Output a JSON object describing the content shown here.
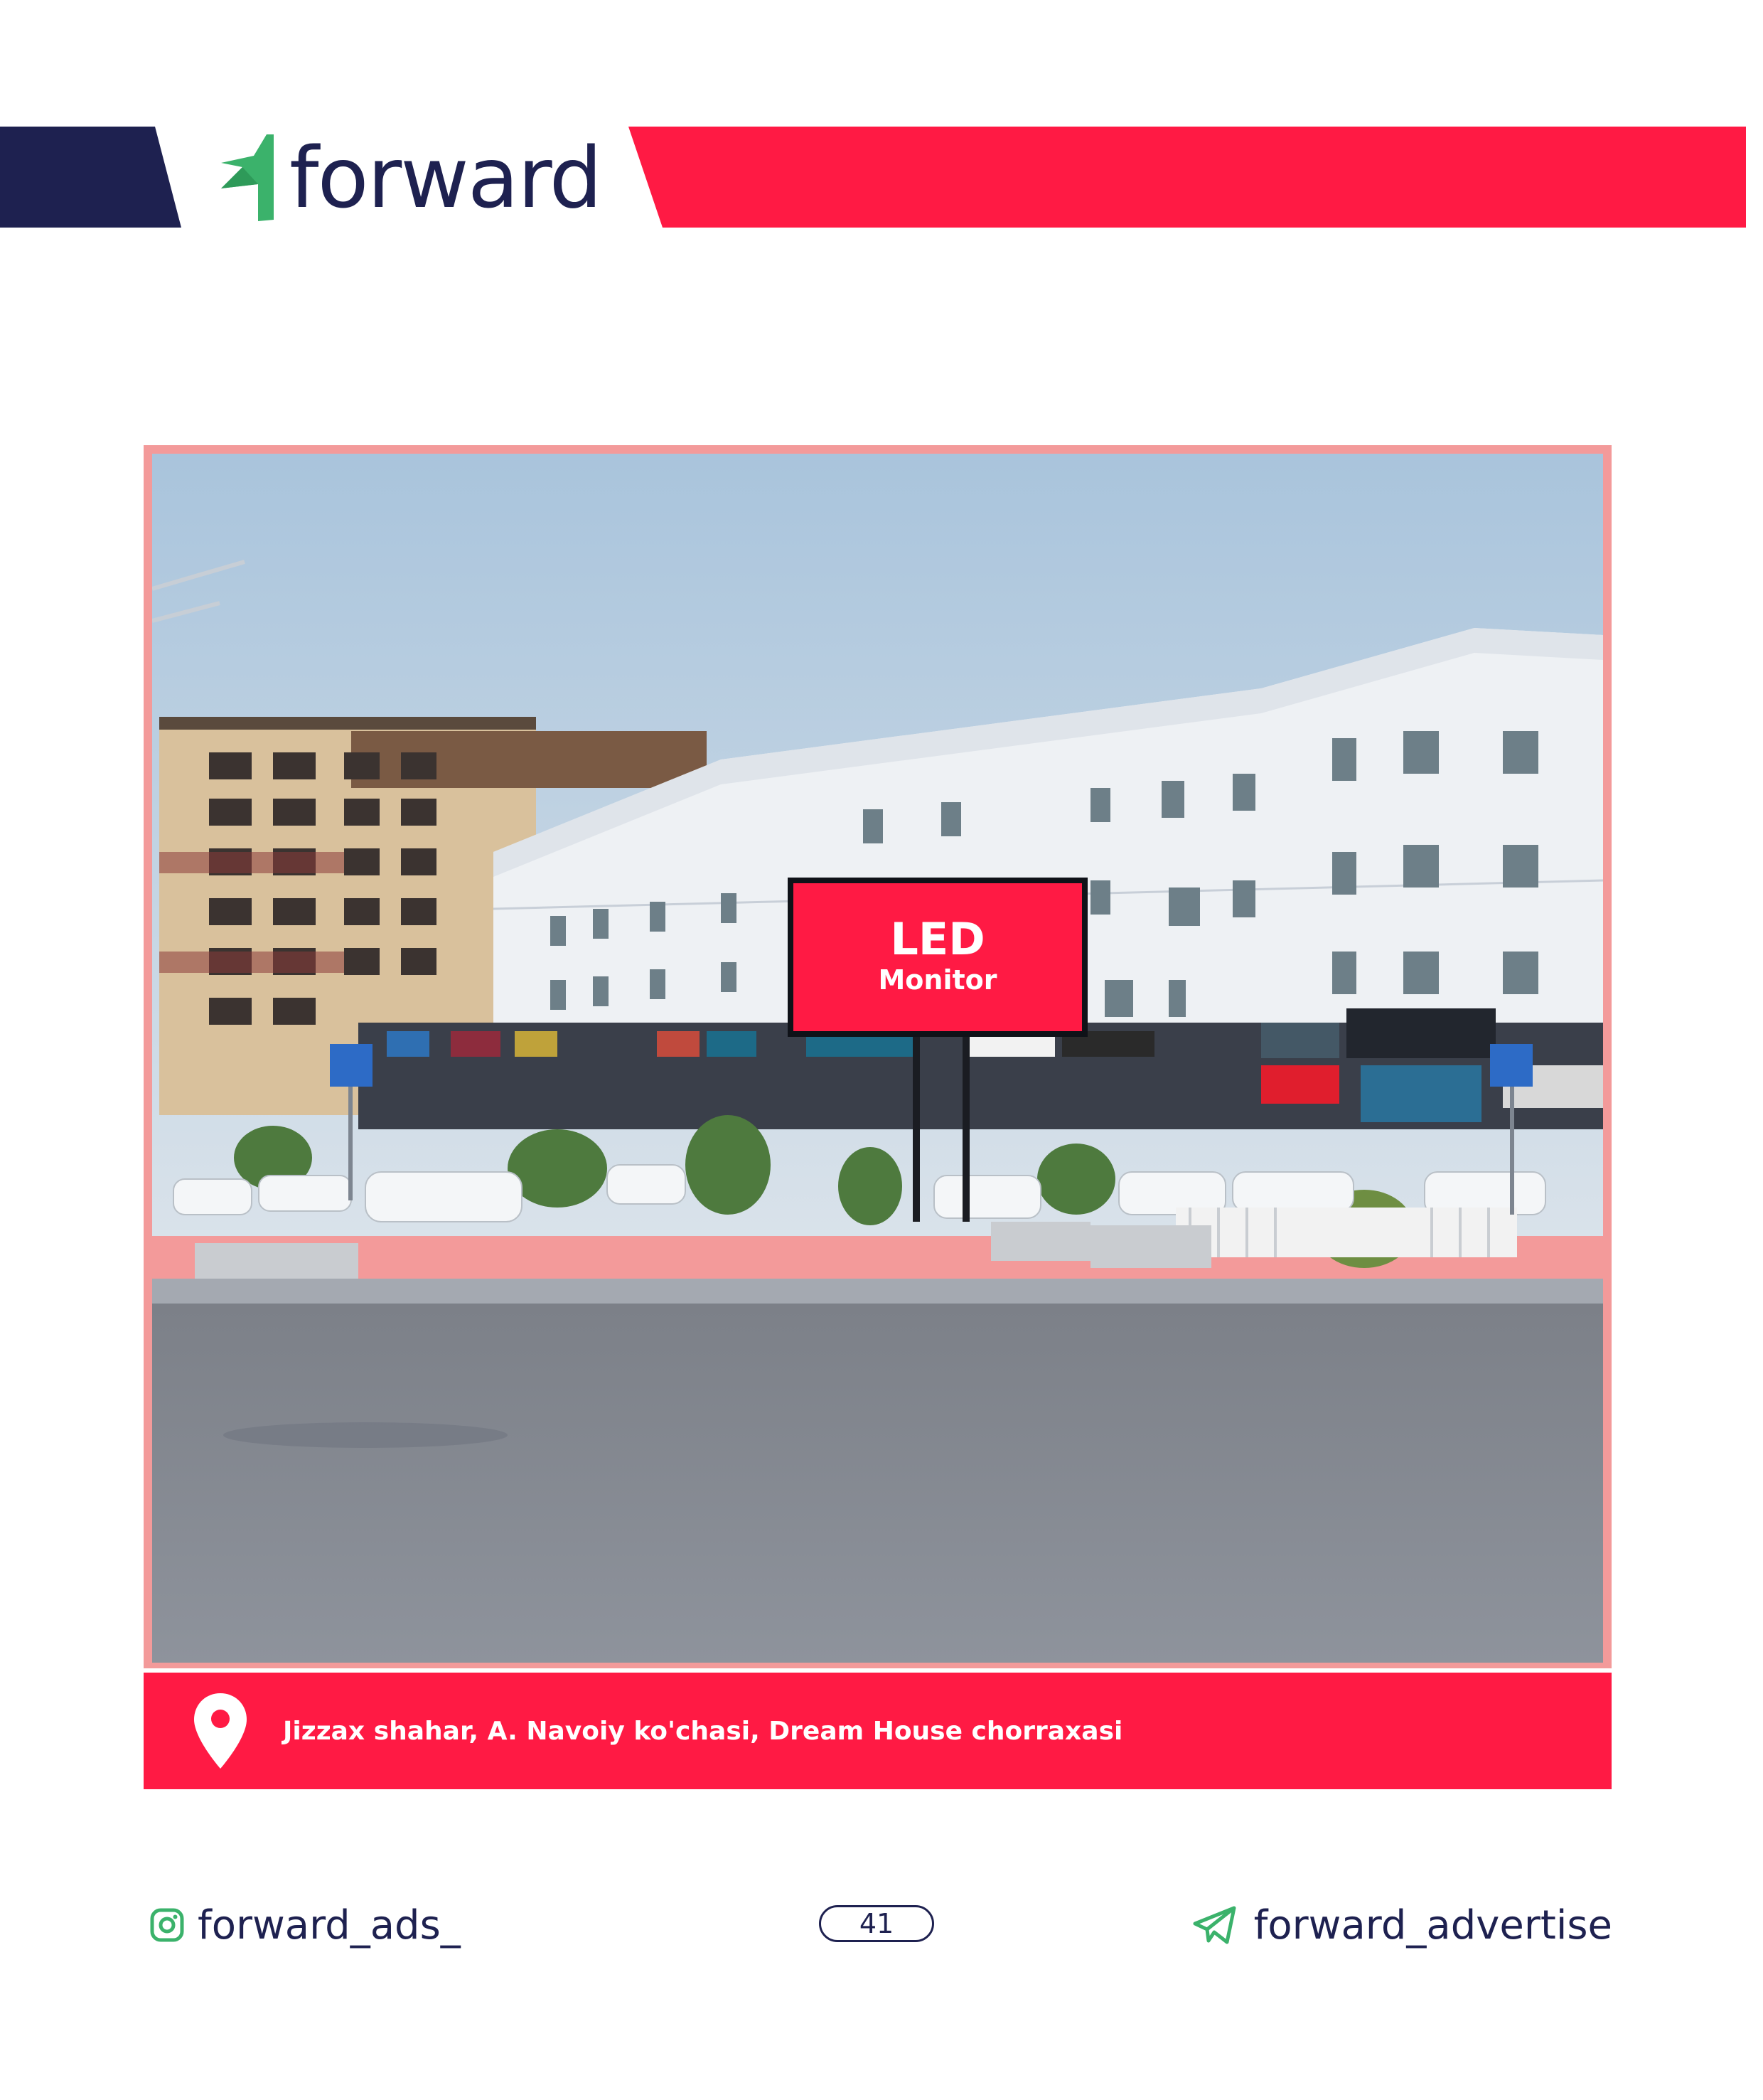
{
  "brand": {
    "name": "forward",
    "colors": {
      "navy": "#1e2150",
      "red": "#ff1a44",
      "green": "#3bb26b",
      "frame": "#f39a9a"
    },
    "logo_icon": "forward-arrow-logo-icon"
  },
  "billboard": {
    "title": "LED",
    "subtitle": "Monitor"
  },
  "location": {
    "icon": "map-pin-icon",
    "address": "Jizzax shahar, A. Navoiy ko'chasi, Dream House chorraxasi"
  },
  "footer": {
    "instagram": {
      "icon": "instagram-icon",
      "handle": "forward_ads_"
    },
    "page_number": "41",
    "telegram": {
      "icon": "telegram-icon",
      "handle": "forward_advertise"
    }
  }
}
